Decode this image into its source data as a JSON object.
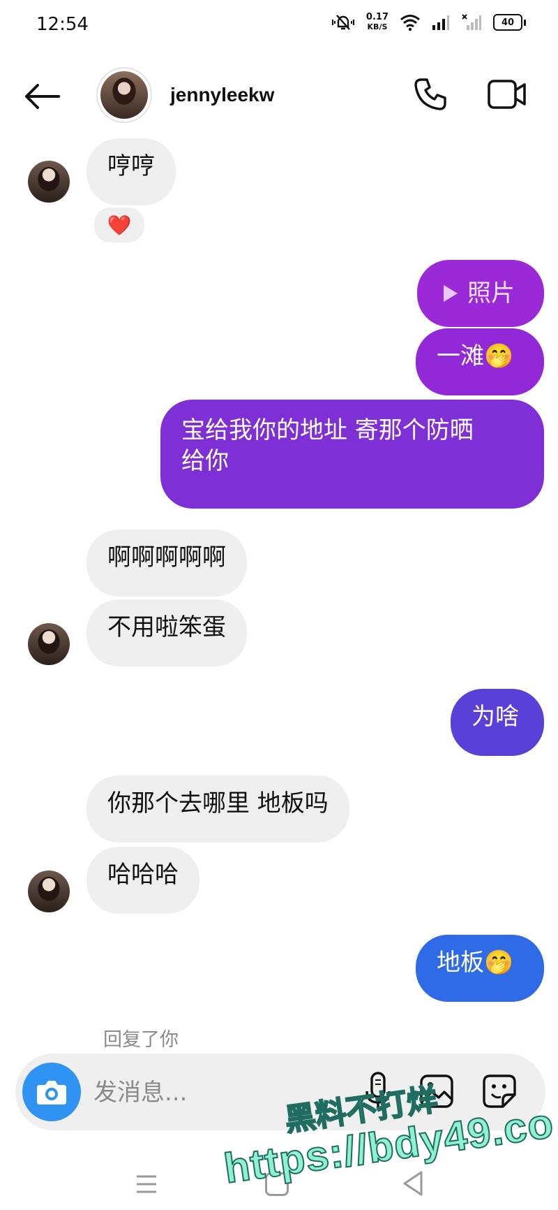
{
  "status_bar": {
    "time": "12:54",
    "net_speed_value": "0.17",
    "net_speed_unit": "KB/S",
    "battery": "40"
  },
  "header": {
    "username": "jennyleekw",
    "back_icon": "arrow-left-icon",
    "call_icon": "phone-icon",
    "video_icon": "video-camera-icon"
  },
  "colors": {
    "incoming_bubble": "#efefef",
    "outgoing_purple_top": "#9b29d8",
    "outgoing_purple_bottom": "#7d2ed6",
    "outgoing_indigo": "#5840d8",
    "outgoing_blue": "#2f6be6",
    "camera_button": "#2e93f3"
  },
  "messages": [
    {
      "direction": "in",
      "text": "哼哼"
    },
    {
      "direction": "in",
      "reaction": "❤️"
    },
    {
      "direction": "out",
      "text": "照片",
      "icon": "play-icon"
    },
    {
      "direction": "out",
      "text": "一滩🤭"
    },
    {
      "direction": "out",
      "text_line1": "宝给我你的地址 寄那个防晒",
      "text_line2": "给你"
    },
    {
      "direction": "in",
      "text": "啊啊啊啊啊"
    },
    {
      "direction": "in",
      "text": "不用啦笨蛋"
    },
    {
      "direction": "out",
      "text": "为啥"
    },
    {
      "direction": "in",
      "text": "你那个去哪里 地板吗"
    },
    {
      "direction": "in",
      "text": "哈哈哈"
    },
    {
      "direction": "out",
      "text": "地板🤭"
    }
  ],
  "reply_hint": "回复了你",
  "composer": {
    "placeholder": "发消息...",
    "camera_icon": "camera-icon",
    "mic_icon": "microphone-icon",
    "gallery_icon": "image-icon",
    "sticker_icon": "sticker-icon"
  },
  "watermark": {
    "line1": "黑料不打烊",
    "line2": "https://bdy49.co"
  }
}
